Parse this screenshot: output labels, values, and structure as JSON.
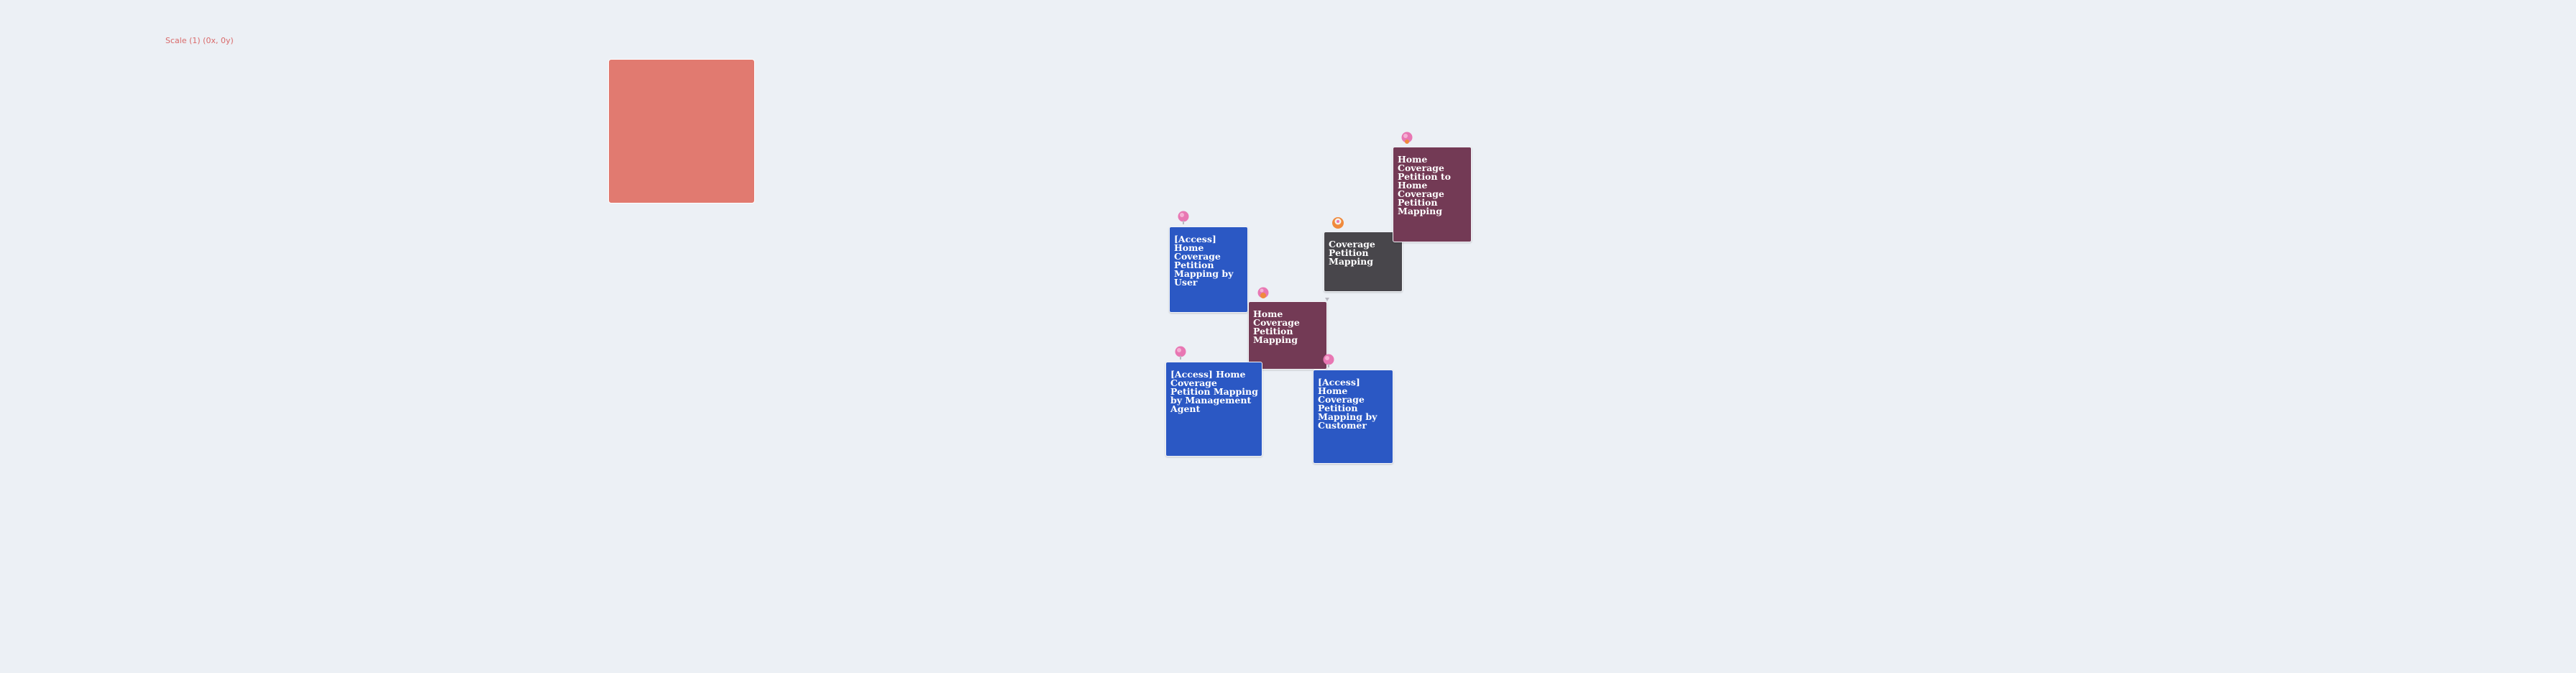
{
  "canvas": {
    "scale_label": "Scale (1) (0x, 0y)"
  },
  "colors": {
    "background": "#ecf0f5",
    "blue_note": "#2b58c4",
    "plum_note": "#733a55",
    "dark_note": "#48464b",
    "large_square": "#e17a70",
    "pin_pink": "#e877b3",
    "pin_orange": "#f08a3c"
  },
  "notes": [
    {
      "id": "note-access-user",
      "text": "[Access] Home Coverage Petition Mapping by User",
      "color": "#2b58c4",
      "pin": "pink-pin-icon"
    },
    {
      "id": "note-home-coverage-mapping",
      "text": "Home Coverage Petition Mapping",
      "color": "#733a55",
      "pin": "pink-orange-pin-icon"
    },
    {
      "id": "note-coverage-mapping",
      "text": "Coverage Petition Mapping",
      "color": "#48464b",
      "pin": "orange-pin-icon"
    },
    {
      "id": "note-petition-to-mapping",
      "text": "Home Coverage Petition to Home Coverage Petition Mapping",
      "color": "#733a55",
      "pin": "pink-pin-icon"
    },
    {
      "id": "note-access-management-agent",
      "text": "[Access] Home Coverage Petition Mapping by Management Agent",
      "color": "#2b58c4",
      "pin": "pink-pin-icon"
    },
    {
      "id": "note-access-customer",
      "text": "[Access] Home Coverage Petition Mapping by Customer",
      "color": "#2b58c4",
      "pin": "pink-pin-icon"
    }
  ]
}
